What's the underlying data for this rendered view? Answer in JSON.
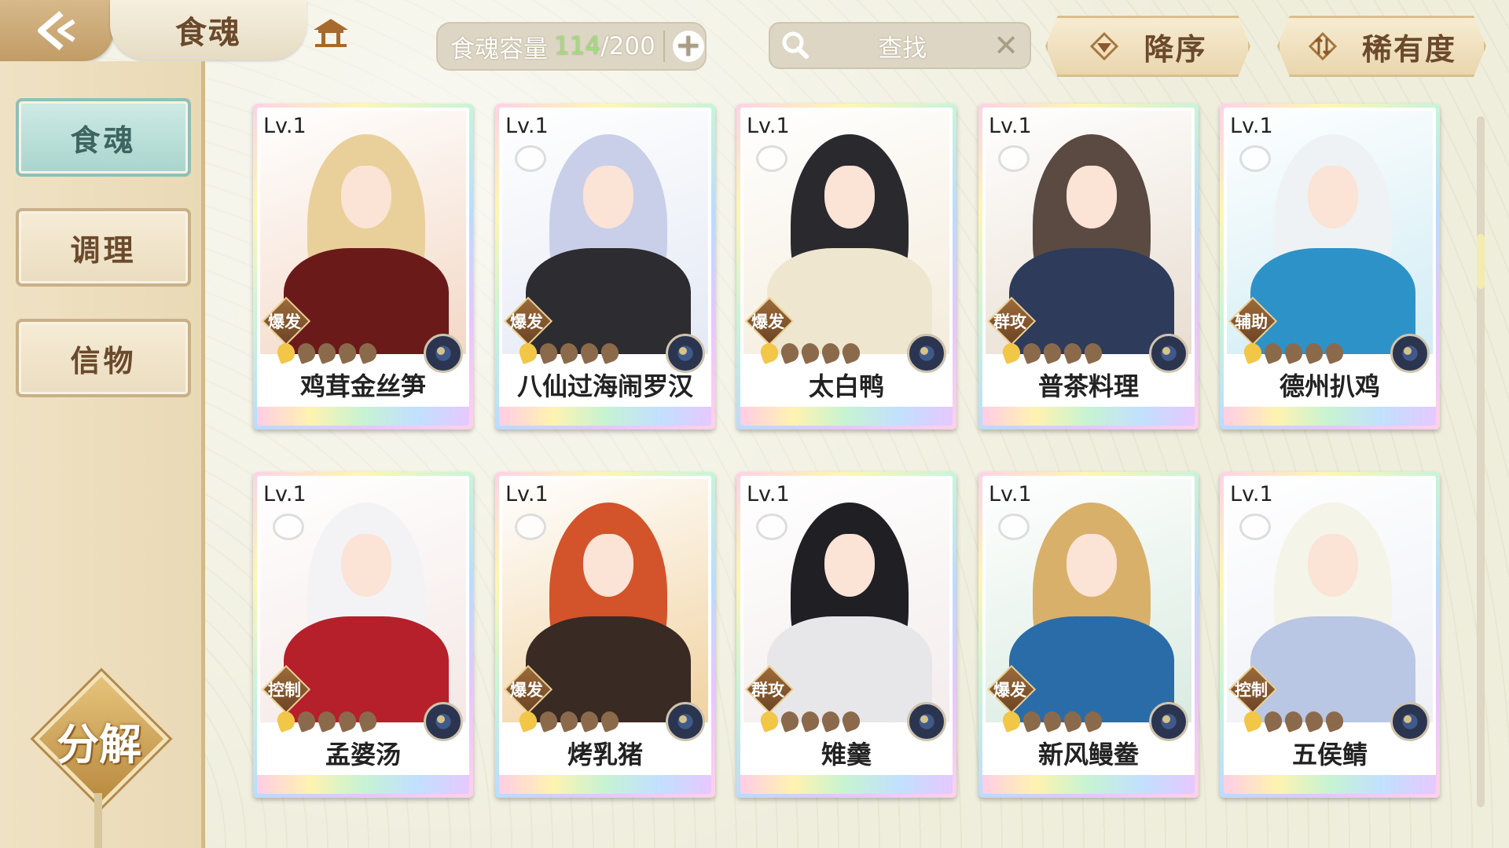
{
  "topbar": {
    "title": "食魂",
    "capacity_label": "食魂容量",
    "capacity_current": "114",
    "capacity_max": "/200",
    "search_placeholder": "查找",
    "sort_order": "降序",
    "sort_by": "稀有度"
  },
  "sidebar": {
    "items": [
      {
        "label": "食魂",
        "active": true
      },
      {
        "label": "调理",
        "active": false
      },
      {
        "label": "信物",
        "active": false
      }
    ],
    "decompose_label": "分解"
  },
  "cards": [
    {
      "level": "Lv.1",
      "name": "鸡茸金丝笋",
      "tag": "爆发",
      "stars": 1,
      "hair": "#e9cf9a",
      "body": "#6b1a1a",
      "bg": "#f3d8c6"
    },
    {
      "level": "Lv.1",
      "name": "八仙过海闹罗汉",
      "tag": "爆发",
      "stars": 1,
      "hair": "#c9cfe8",
      "body": "#2d2c30",
      "bg": "#e4e9f4"
    },
    {
      "level": "Lv.1",
      "name": "太白鸭",
      "tag": "爆发",
      "stars": 1,
      "hair": "#2a2a2e",
      "body": "#efe6d0",
      "bg": "#f4ecdc"
    },
    {
      "level": "Lv.1",
      "name": "普茶料理",
      "tag": "群攻",
      "stars": 1,
      "hair": "#5a4a42",
      "body": "#2e3b5a",
      "bg": "#e8ddd0"
    },
    {
      "level": "Lv.1",
      "name": "德州扒鸡",
      "tag": "辅助",
      "stars": 1,
      "hair": "#eef2f4",
      "body": "#2d92c8",
      "bg": "#d0ecf4"
    },
    {
      "level": "Lv.1",
      "name": "孟婆汤",
      "tag": "控制",
      "stars": 1,
      "hair": "#f3f3f6",
      "body": "#b5202a",
      "bg": "#f4e8e6"
    },
    {
      "level": "Lv.1",
      "name": "烤乳猪",
      "tag": "爆发",
      "stars": 1,
      "hair": "#d3532a",
      "body": "#3a2a24",
      "bg": "#f1d2a0"
    },
    {
      "level": "Lv.1",
      "name": "雉羹",
      "tag": "群攻",
      "stars": 1,
      "hair": "#1f1f24",
      "body": "#e7e7ea",
      "bg": "#f4ecec"
    },
    {
      "level": "Lv.1",
      "name": "新风鳗鲞",
      "tag": "爆发",
      "stars": 1,
      "hair": "#d8b06a",
      "body": "#2a6ca8",
      "bg": "#d9ebe0"
    },
    {
      "level": "Lv.1",
      "name": "五侯鲭",
      "tag": "控制",
      "stars": 1,
      "hair": "#f4f4e8",
      "body": "#b9c6e4",
      "bg": "#eef0f6"
    }
  ]
}
